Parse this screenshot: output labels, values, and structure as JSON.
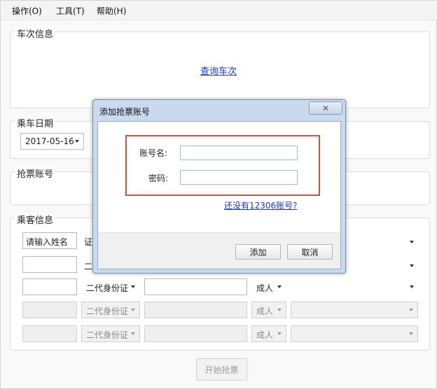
{
  "menu": [
    "操作(O)",
    "工具(T)",
    "帮助(H)"
  ],
  "train_group": {
    "label": "车次信息",
    "query_link": "查询车次"
  },
  "date_group": {
    "label": "乘车日期",
    "date_value": "2017-05-16"
  },
  "account_group": {
    "label": "抢票账号"
  },
  "passenger_group": {
    "label": "乘客信息",
    "name_placeholder": "请输入姓名",
    "id_type_partial": "证",
    "id_type_partial2": "二",
    "id_type": "二代身份证",
    "ticket_type": "成人"
  },
  "start_button": "开始抢票",
  "dialog": {
    "title": "添加抢票账号",
    "close_glyph": "✕",
    "account_label": "账号名:",
    "password_label": "密码:",
    "register_link": "还没有12306账号?",
    "add_button": "添加",
    "cancel_button": "取消"
  }
}
